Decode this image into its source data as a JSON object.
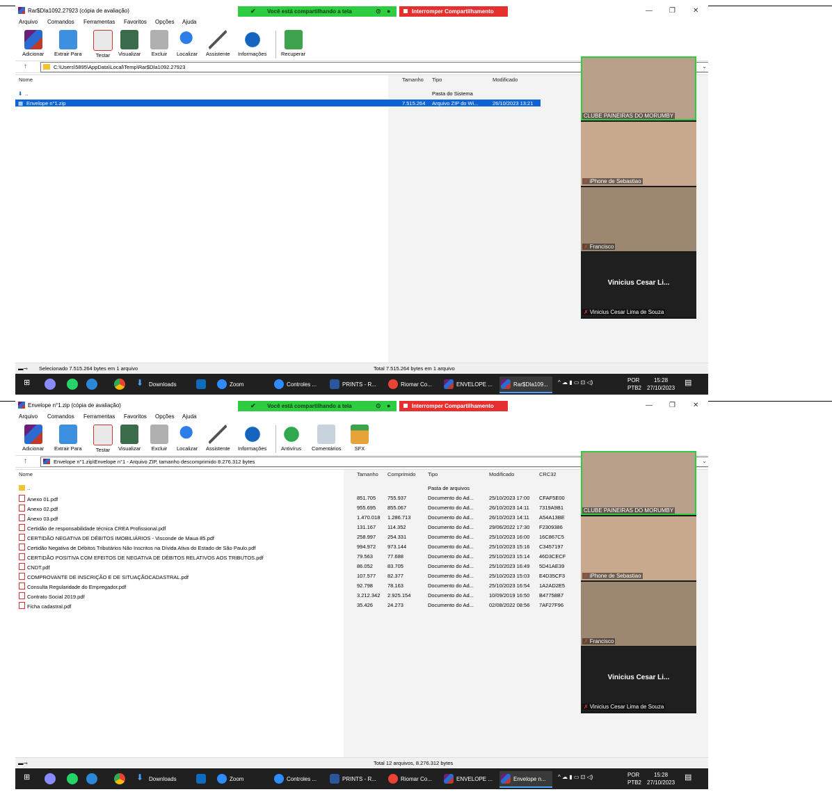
{
  "shot1": {
    "window_title": "Rar$DIa1092.27923 (cópia de avaliação)",
    "share_text": "Você está compartilhando a tela",
    "stop_share": "Interromper Compartilhamento",
    "menu": [
      "Arquivo",
      "Comandos",
      "Ferramentas",
      "Favoritos",
      "Opções",
      "Ajuda"
    ],
    "toolbar": [
      "Adicionar",
      "Extrair Para",
      "Testar",
      "Visualizar",
      "Excluir",
      "Localizar",
      "Assistente",
      "Informações",
      "Recuperar"
    ],
    "path": "C:\\Users\\5895\\AppData\\Local\\Temp\\Rar$DIa1092.27923",
    "columns": [
      "Nome",
      "Tamanho",
      "Tipo",
      "Modificado"
    ],
    "rows": [
      {
        "name": "..",
        "size": "",
        "type": "Pasta do Sistema",
        "modified": ""
      },
      {
        "name": "Envelope n°1.zip",
        "size": "7.515.264",
        "type": "Arquivo ZIP do Wi...",
        "modified": "26/10/2023 13:21"
      }
    ],
    "status_left": "Selecionado 7.515.264 bytes em 1 arquivo",
    "status_right": "Total 7.515.264 bytes em 1 arquivo"
  },
  "shot2": {
    "window_title": "Envelope n°1.zip (cópia de avaliação)",
    "share_text": "Você está compartilhando a tela",
    "stop_share": "Interromper Compartilhamento",
    "menu": [
      "Arquivo",
      "Comandos",
      "Ferramentas",
      "Favoritos",
      "Opções",
      "Ajuda"
    ],
    "toolbar": [
      "Adicionar",
      "Extrair Para",
      "Testar",
      "Visualizar",
      "Excluir",
      "Localizar",
      "Assistente",
      "Informações",
      "Antivírus",
      "Comentários",
      "SFX"
    ],
    "path": "Envelope n°1.zip\\Envelope n°1 - Arquivo ZIP, tamanho descomprimido 8.276.312 bytes",
    "columns": [
      "Nome",
      "Tamanho",
      "Comprimido",
      "Tipo",
      "Modificado",
      "CRC32"
    ],
    "rows": [
      {
        "name": "..",
        "size": "",
        "packed": "",
        "type": "Pasta de arquivos",
        "modified": "",
        "crc": ""
      },
      {
        "name": "Anexo 01.pdf",
        "size": "851.705",
        "packed": "755.937",
        "type": "Documento do Ad...",
        "modified": "25/10/2023 17:00",
        "crc": "CFAF5E00"
      },
      {
        "name": "Anexo 02.pdf",
        "size": "955.695",
        "packed": "855.067",
        "type": "Documento do Ad...",
        "modified": "26/10/2023 14:11",
        "crc": "7319A9B1"
      },
      {
        "name": "Anexo 03.pdf",
        "size": "1.470.018",
        "packed": "1.286.713",
        "type": "Documento do Ad...",
        "modified": "26/10/2023 14:11",
        "crc": "A54A13BE"
      },
      {
        "name": "Certidão de responsabilidade técnica CREA Profissional.pdf",
        "size": "131.167",
        "packed": "114.352",
        "type": "Documento do Ad...",
        "modified": "29/06/2022 17:30",
        "crc": "F2309386"
      },
      {
        "name": "CERTIDÃO NEGATIVA DE DÉBITOS IMOBILIÁRIOS - Visconde de Maua 85.pdf",
        "size": "258.997",
        "packed": "254.331",
        "type": "Documento do Ad...",
        "modified": "25/10/2023 16:00",
        "crc": "16C867C5"
      },
      {
        "name": "Certidão Negativa de Débitos Tributários Não Inscritos na Dívida Ativa do Estado de São Paulo.pdf",
        "size": "994.972",
        "packed": "973.144",
        "type": "Documento do Ad...",
        "modified": "25/10/2023 15:16",
        "crc": "C3457197"
      },
      {
        "name": "CERTIDÃO POSITIVA COM EFEITOS DE NEGATIVA DE DÉBITOS RELATIVOS AOS TRIBUTOS.pdf",
        "size": "79.563",
        "packed": "77.688",
        "type": "Documento do Ad...",
        "modified": "25/10/2023 15:14",
        "crc": "46D3CECF"
      },
      {
        "name": "CNDT.pdf",
        "size": "86.052",
        "packed": "83.705",
        "type": "Documento do Ad...",
        "modified": "25/10/2023 16:49",
        "crc": "5D41AE39"
      },
      {
        "name": "COMPROVANTE DE INSCRIÇÃO E DE SITUAÇÃOCADASTRAL.pdf",
        "size": "107.577",
        "packed": "82.377",
        "type": "Documento do Ad...",
        "modified": "25/10/2023 15:03",
        "crc": "E4D35CF3"
      },
      {
        "name": "Consulta Regularidade do Empregador.pdf",
        "size": "92.798",
        "packed": "78.163",
        "type": "Documento do Ad...",
        "modified": "25/10/2023 16:54",
        "crc": "1A2AD2E5"
      },
      {
        "name": "Contrato Social 2019.pdf",
        "size": "3.212.342",
        "packed": "2.925.154",
        "type": "Documento do Ad...",
        "modified": "10/09/2019 16:50",
        "crc": "B47758B7"
      },
      {
        "name": "Ficha cadastral.pdf",
        "size": "35.426",
        "packed": "24.273",
        "type": "Documento do Ad...",
        "modified": "02/08/2022 08:56",
        "crc": "7AF27F96"
      }
    ],
    "status_left": "",
    "status_right": "Total 12 arquivos, 8.276.312 bytes"
  },
  "participants": [
    {
      "name": "CLUBE PAINEIRAS DO MORUMBY",
      "muted": false,
      "bg": "#b8a08a"
    },
    {
      "name": "iPhone de Sebastiao",
      "muted": true,
      "bg": "#c9a98e"
    },
    {
      "name": "Francisco",
      "muted": true,
      "bg": "#9c8770"
    },
    {
      "name": "Vinicius Cesar Lima de Souza",
      "short": "Vinicius Cesar Li...",
      "muted": true,
      "bg": "#1f1f1f"
    }
  ],
  "taskbar": {
    "downloads": "Downloads",
    "zoom": "Zoom",
    "controles": "Controles ...",
    "prints": "PRINTS - R...",
    "riomar": "Riomar Co...",
    "envelope": "ENVELOPE ...",
    "active1": "Rar$DIa109...",
    "active2": "Envelope n...",
    "lang1": "POR",
    "lang2": "PTB2",
    "time": "15:28",
    "date": "27/10/2023"
  }
}
